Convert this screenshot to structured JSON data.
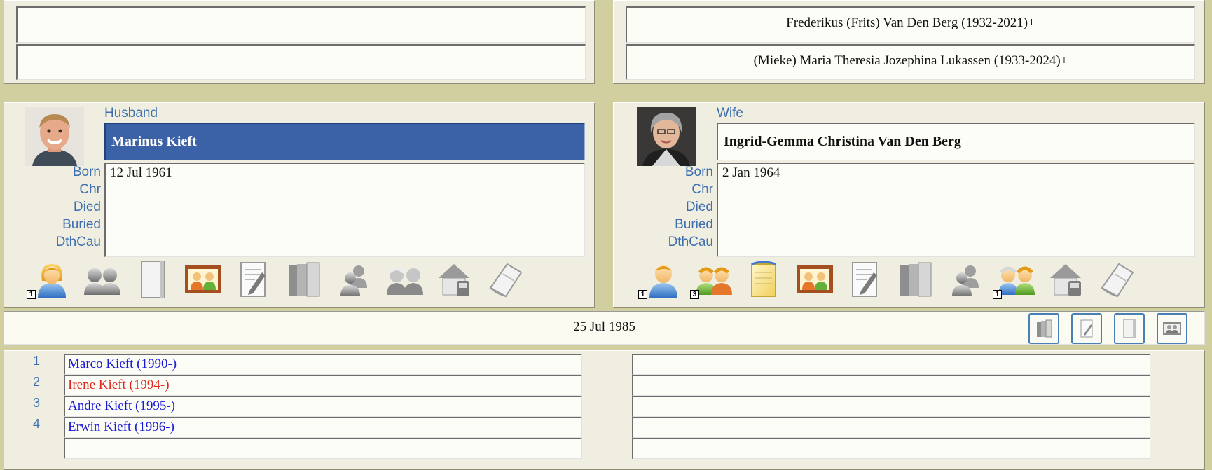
{
  "parents": {
    "husband_father": "",
    "husband_mother": "",
    "wife_father": "Frederikus (Frits) Van Den Berg (1932-2021)+",
    "wife_mother": "(Mieke) Maria Theresia Jozephina Lukassen (1933-2024)+"
  },
  "husband": {
    "role_label": "Husband",
    "name": "Marinus Kieft",
    "event_labels": [
      "Born",
      "Chr",
      "Died",
      "Buried",
      "DthCau"
    ],
    "events_text": "12 Jul 1961",
    "badges": {
      "person": "1"
    },
    "icons": [
      "person-female-icon",
      "couple-icon",
      "note-icon",
      "picture-icon",
      "edit-document-icon",
      "books-icon",
      "relatives-icon",
      "parents-icon",
      "address-icon",
      "source-icon"
    ]
  },
  "wife": {
    "role_label": "Wife",
    "name": "Ingrid-Gemma Christina Van Den Berg",
    "event_labels": [
      "Born",
      "Chr",
      "Died",
      "Buried",
      "DthCau"
    ],
    "events_text": "2 Jan 1964",
    "badges": {
      "person": "1",
      "couple": "3",
      "parents": "1"
    },
    "icons": [
      "person-male-icon",
      "couple-icon",
      "note-icon",
      "picture-icon",
      "edit-document-icon",
      "books-icon",
      "relatives-icon",
      "parents-icon",
      "address-icon",
      "source-icon"
    ]
  },
  "marriage": {
    "date": "25 Jul 1985",
    "buttons": [
      "books-icon",
      "edit-document-icon",
      "note-icon",
      "picture-icon"
    ]
  },
  "children": [
    {
      "num": "1",
      "name": "Marco Kieft (1990-)",
      "color": "#1a1ad6"
    },
    {
      "num": "2",
      "name": "Irene Kieft (1994-)",
      "color": "#e0261c"
    },
    {
      "num": "3",
      "name": "Andre Kieft (1995-)",
      "color": "#1a1ad6"
    },
    {
      "num": "4",
      "name": "Erwin Kieft (1996-)",
      "color": "#1a1ad6"
    },
    {
      "num": "",
      "name": "",
      "color": "#1a1ad6"
    }
  ],
  "colors": {
    "background": "#d1cfa0",
    "selected": "#3b62a7",
    "label": "#3d6fae",
    "male_child": "#1a1ad6",
    "female_child": "#e0261c"
  }
}
